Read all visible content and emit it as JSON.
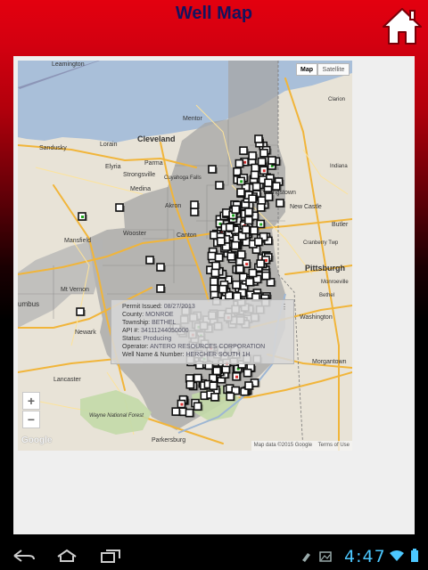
{
  "header": {
    "title": "Well Map",
    "home_icon": "home-icon"
  },
  "map": {
    "type_buttons": [
      "Map",
      "Satellite"
    ],
    "active_type": "Map",
    "zoom_in": "+",
    "zoom_out": "−",
    "logo": "Google",
    "attribution": "Map data ©2015 Google",
    "terms": "Terms of Use",
    "places": [
      {
        "name": "Leamington"
      },
      {
        "name": "Mentor"
      },
      {
        "name": "Sandusky"
      },
      {
        "name": "Lorain"
      },
      {
        "name": "Cleveland"
      },
      {
        "name": "Elyria"
      },
      {
        "name": "Parma"
      },
      {
        "name": "Strongsville"
      },
      {
        "name": "Cuyahoga Falls"
      },
      {
        "name": "Medina"
      },
      {
        "name": "Akron"
      },
      {
        "name": "Youngstown"
      },
      {
        "name": "New Castle"
      },
      {
        "name": "Mansfield"
      },
      {
        "name": "Wooster"
      },
      {
        "name": "Canton"
      },
      {
        "name": "Butler"
      },
      {
        "name": "Cranberry Twp"
      },
      {
        "name": "Pittsburgh"
      },
      {
        "name": "Mt Vernon"
      },
      {
        "name": "Newark"
      },
      {
        "name": "Washington"
      },
      {
        "name": "Lancaster"
      },
      {
        "name": "Morgantown"
      },
      {
        "name": "Wayne National Forest"
      },
      {
        "name": "Parkersburg"
      },
      {
        "name": "umbus"
      },
      {
        "name": "Clarion"
      },
      {
        "name": "Bethel"
      },
      {
        "name": "Indiana"
      },
      {
        "name": "Monroeville"
      }
    ]
  },
  "info_window": {
    "rows": [
      {
        "label": "Permit Issued:",
        "value": "08/27/2013"
      },
      {
        "label": "County:",
        "value": "MONROE"
      },
      {
        "label": "Township:",
        "value": "BETHEL"
      },
      {
        "label": "API #:",
        "value": "34111244050000"
      },
      {
        "label": "Status:",
        "value": "Producing"
      },
      {
        "label": "Operator:",
        "value": "ANTERO RESOURCES CORPORATION"
      },
      {
        "label": "Well Name & Number:",
        "value": "HERCHER SOUTH 1H"
      }
    ],
    "close": "⋮"
  },
  "system_bar": {
    "time": "4:47",
    "back_icon": "back-icon",
    "home_icon": "home-nav-icon",
    "recents_icon": "recents-icon"
  },
  "colors": {
    "header_red": "#e3000f",
    "title_navy": "#13135e",
    "clock_blue": "#4cc8ff",
    "lake_erie": "#a9bfd9",
    "shale_region": "#a5a5a5"
  }
}
